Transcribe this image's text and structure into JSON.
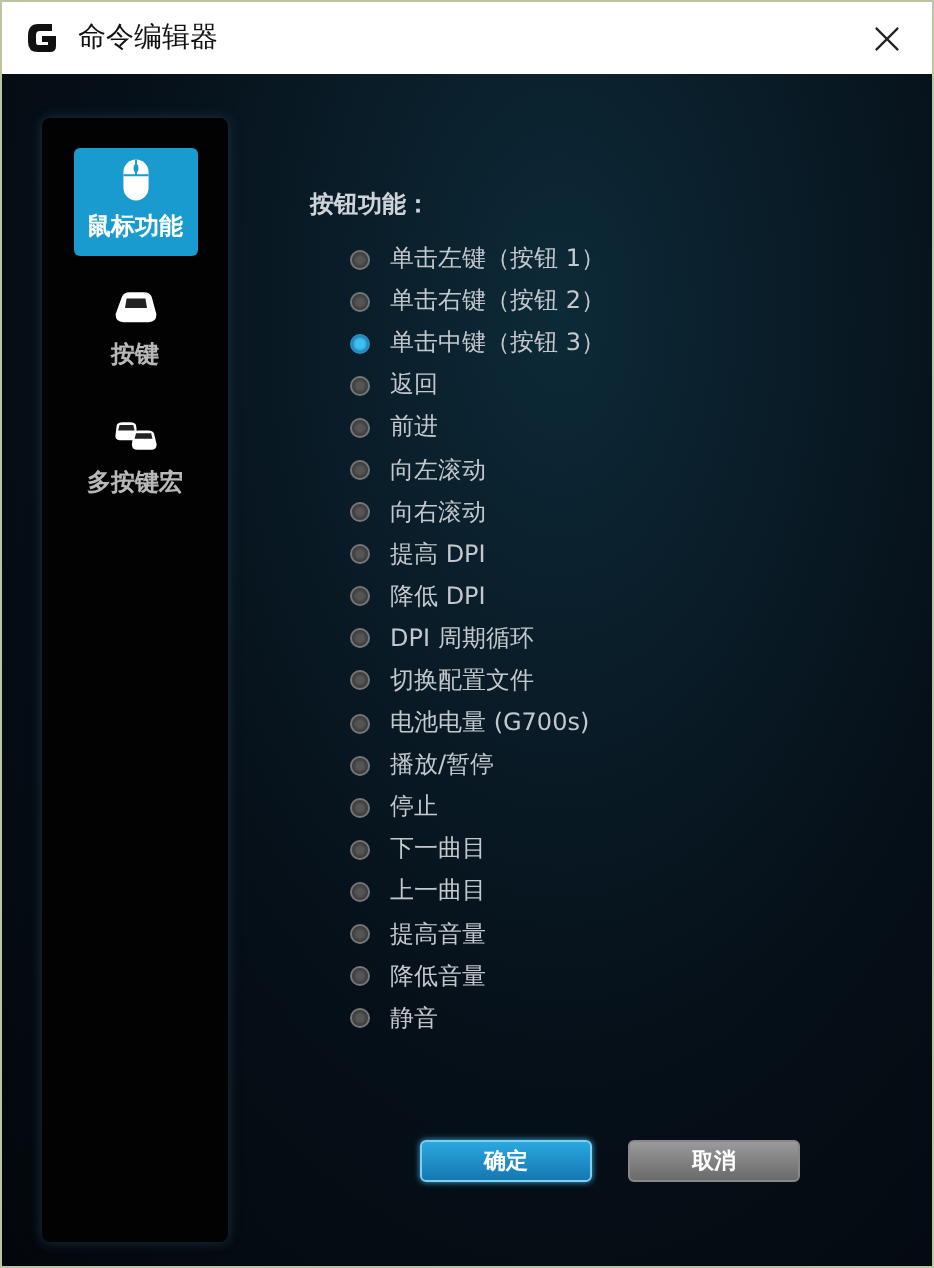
{
  "window": {
    "title": "命令编辑器"
  },
  "sidebar": {
    "items": [
      {
        "kind": "mouse",
        "label": "鼠标功能",
        "selected": true
      },
      {
        "kind": "key",
        "label": "按键",
        "selected": false
      },
      {
        "kind": "keys",
        "label": "多按键宏",
        "selected": false
      }
    ]
  },
  "section_label": "按钮功能：",
  "options": [
    {
      "label": "单击左键（按钮 1）",
      "selected": false
    },
    {
      "label": "单击右键（按钮 2）",
      "selected": false
    },
    {
      "label": "单击中键（按钮 3）",
      "selected": true
    },
    {
      "label": "返回",
      "selected": false
    },
    {
      "label": "前进",
      "selected": false
    },
    {
      "label": "向左滚动",
      "selected": false
    },
    {
      "label": "向右滚动",
      "selected": false
    },
    {
      "label": "提高 DPI",
      "selected": false
    },
    {
      "label": "降低 DPI",
      "selected": false
    },
    {
      "label": "DPI 周期循环",
      "selected": false
    },
    {
      "label": "切换配置文件",
      "selected": false
    },
    {
      "label": "电池电量 (G700s)",
      "selected": false
    },
    {
      "label": "播放/暂停",
      "selected": false
    },
    {
      "label": "停止",
      "selected": false
    },
    {
      "label": "下一曲目",
      "selected": false
    },
    {
      "label": "上一曲目",
      "selected": false
    },
    {
      "label": "提高音量",
      "selected": false
    },
    {
      "label": "降低音量",
      "selected": false
    },
    {
      "label": "静音",
      "selected": false
    }
  ],
  "buttons": [
    {
      "kind": "primary",
      "label": "确定"
    },
    {
      "kind": "secondary",
      "label": "取消"
    }
  ]
}
